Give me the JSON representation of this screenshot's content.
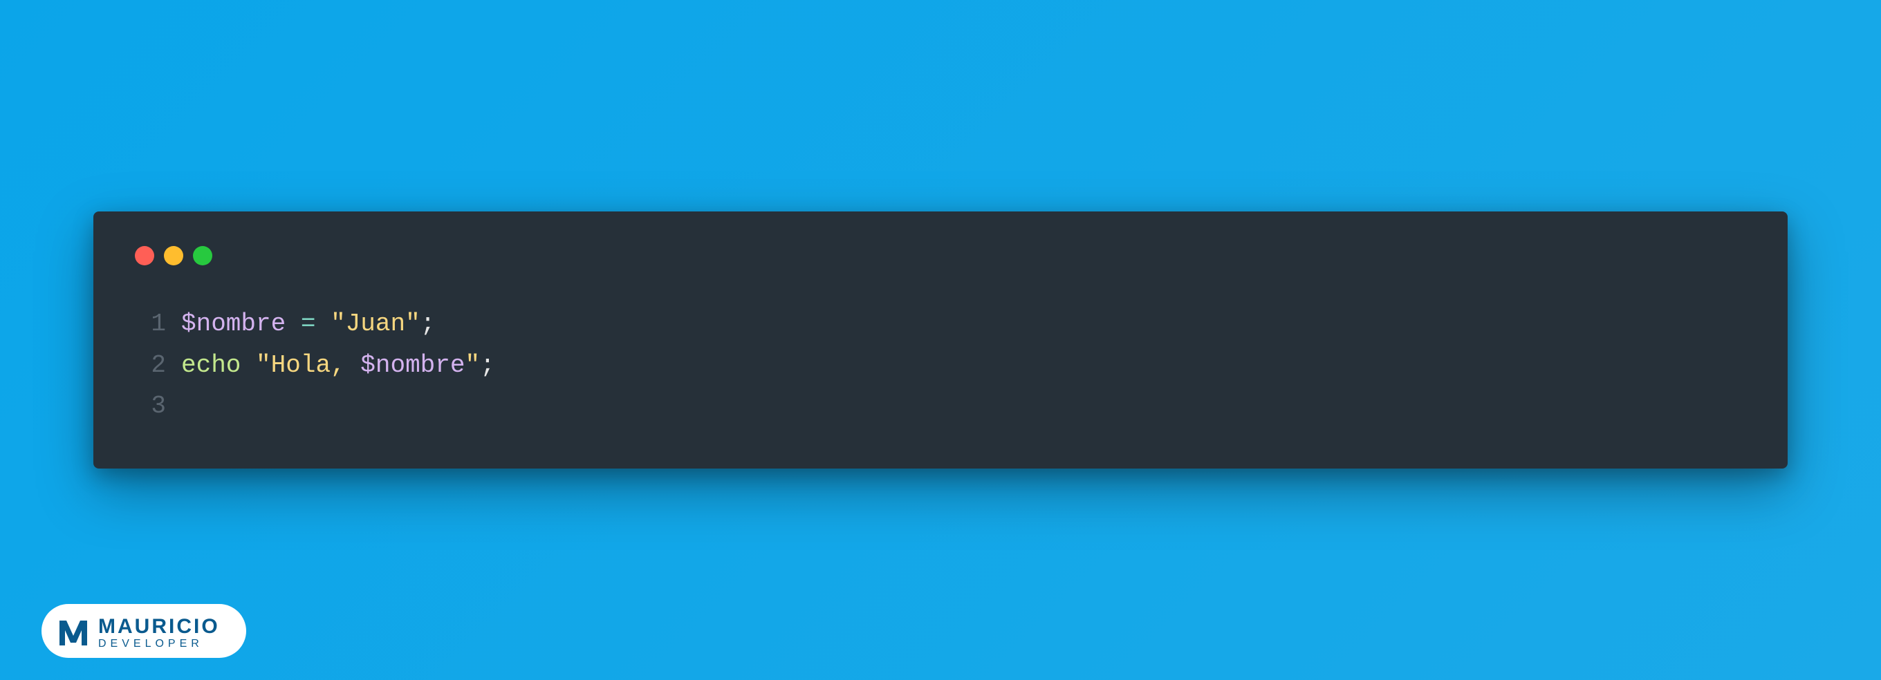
{
  "window": {
    "controls": {
      "close_color": "#FF5F56",
      "minimize_color": "#FFBD2E",
      "maximize_color": "#27C93F"
    }
  },
  "code": {
    "lines": [
      {
        "number": "1",
        "tokens": [
          {
            "text": "$nombre",
            "class": "tok-variable"
          },
          {
            "text": " ",
            "class": "tok-punctuation"
          },
          {
            "text": "=",
            "class": "tok-operator"
          },
          {
            "text": " ",
            "class": "tok-punctuation"
          },
          {
            "text": "\"Juan\"",
            "class": "tok-string"
          },
          {
            "text": ";",
            "class": "tok-punctuation"
          }
        ]
      },
      {
        "number": "2",
        "tokens": [
          {
            "text": "echo",
            "class": "tok-keyword"
          },
          {
            "text": " ",
            "class": "tok-punctuation"
          },
          {
            "text": "\"Hola, ",
            "class": "tok-string"
          },
          {
            "text": "$nombre",
            "class": "tok-interpolation"
          },
          {
            "text": "\"",
            "class": "tok-string"
          },
          {
            "text": ";",
            "class": "tok-punctuation"
          }
        ]
      },
      {
        "number": "3",
        "tokens": []
      }
    ]
  },
  "logo": {
    "name": "MAURICIO",
    "sub": "DEVELOPER"
  }
}
